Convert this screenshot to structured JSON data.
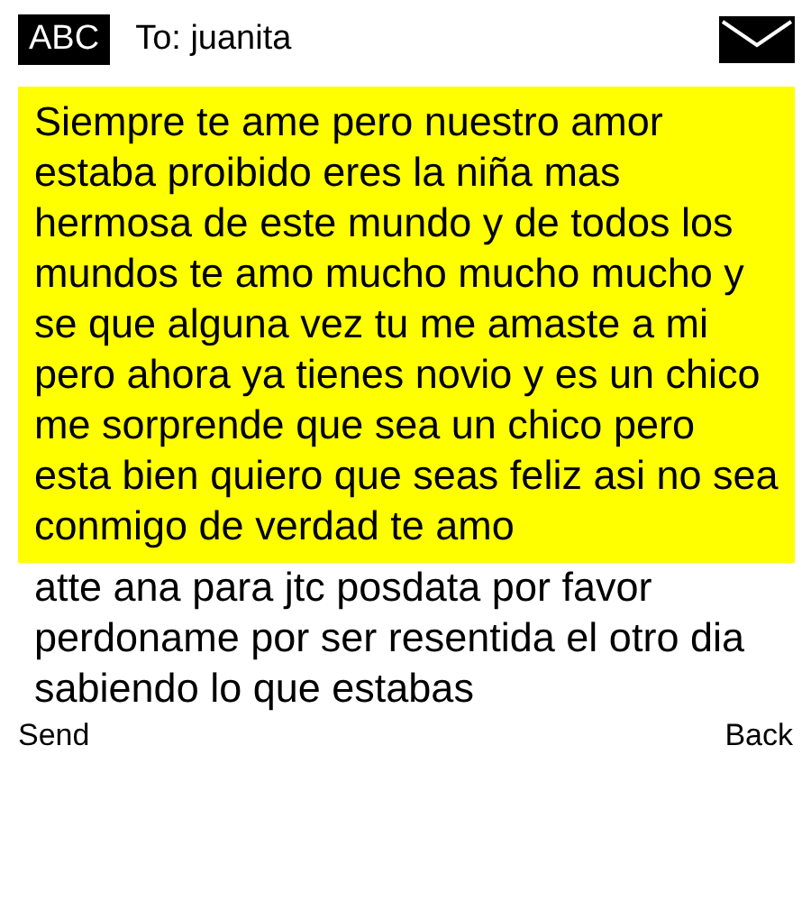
{
  "header": {
    "input_mode": "ABC",
    "recipient": "To: juanita"
  },
  "message": {
    "body": "Siempre te ame pero nuestro amor estaba proibido eres la niña mas hermosa de este mundo y de todos los mundos te amo mucho mucho mucho y se que alguna vez tu me amaste a mi pero ahora ya tienes novio y es un chico me sorprende que sea un chico pero esta bien quiero que seas feliz asi no sea conmigo de verdad te amo",
    "overflow": "atte ana para jtc  posdata por favor perdoname por ser resentida el otro dia sabiendo lo que estabas"
  },
  "softkeys": {
    "left": "Send",
    "right": "Back"
  }
}
